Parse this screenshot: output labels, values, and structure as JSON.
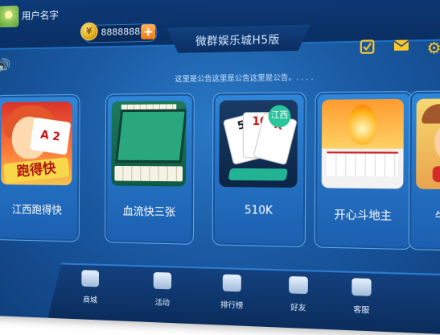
{
  "header": {
    "username": "用户名字",
    "coins": "88888888",
    "add_label": "+",
    "coin_symbol": "¥",
    "title": "微群娱乐城H5版"
  },
  "notice": {
    "text": "这里是公告这里是公告这里是公告。. . . ."
  },
  "games": [
    {
      "label": "江西跑得快",
      "thumb_text": "跑得快",
      "card_text": "A 2"
    },
    {
      "label": "血流快三张"
    },
    {
      "label": "510K",
      "badge": "江西",
      "cards": [
        "5",
        "10",
        "K"
      ]
    },
    {
      "label": "开心斗地主"
    },
    {
      "label": "牛仔抖牛"
    }
  ],
  "nav": [
    {
      "label": "商城",
      "icon": "shop-icon"
    },
    {
      "label": "活动",
      "icon": "gift-icon"
    },
    {
      "label": "排行榜",
      "icon": "trophy-icon"
    },
    {
      "label": "好友",
      "icon": "friends-icon"
    },
    {
      "label": "客服",
      "icon": "headset-icon"
    }
  ],
  "colors": {
    "accent": "#ffc628",
    "panel": "#1a5aa3",
    "plus_button": "#ef7a12"
  }
}
